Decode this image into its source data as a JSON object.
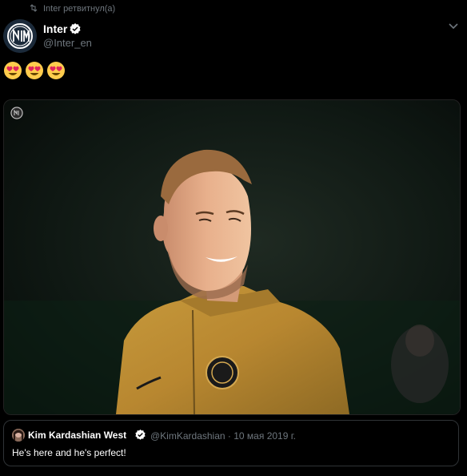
{
  "retweet": {
    "icon": "retweet-icon",
    "text": "Inter ретвитнул(а)"
  },
  "tweet": {
    "author": {
      "name": "Inter",
      "handle": "@Inter_en",
      "verified": true,
      "avatar": "inter-logo"
    },
    "emojis": [
      "😍",
      "😍",
      "😍"
    ],
    "media": {
      "badge_icon": "inter-logo-icon"
    },
    "menu_icon": "chevron-down-icon"
  },
  "quoted_tweet": {
    "author_name": "Kim Kardashian West",
    "verified": true,
    "handle": "@KimKardashian",
    "separator": "·",
    "date": "10 мая 2019 г.",
    "text": "He's here and he's perfect!"
  },
  "colors": {
    "background": "#000000",
    "muted_text": "#6e767d",
    "verified_badge": "#ffffff",
    "border": "#2f3336"
  }
}
